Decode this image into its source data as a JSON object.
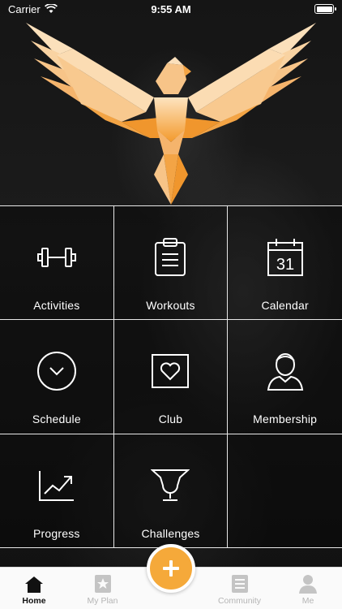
{
  "status_bar": {
    "carrier": "Carrier",
    "time": "9:55 AM"
  },
  "grid": [
    {
      "label": "Activities",
      "icon": "dumbbell-icon"
    },
    {
      "label": "Workouts",
      "icon": "clipboard-icon"
    },
    {
      "label": "Calendar",
      "icon": "calendar-icon",
      "icon_text": "31"
    },
    {
      "label": "Schedule",
      "icon": "chevron-circle-icon"
    },
    {
      "label": "Club",
      "icon": "heart-box-icon"
    },
    {
      "label": "Membership",
      "icon": "user-icon"
    },
    {
      "label": "Progress",
      "icon": "trend-chart-icon"
    },
    {
      "label": "Challenges",
      "icon": "trophy-icon"
    },
    {
      "label": "",
      "icon": ""
    }
  ],
  "tabbar": {
    "home": "Home",
    "my_plan": "My Plan",
    "community": "Community",
    "me": "Me"
  },
  "colors": {
    "accent": "#f5a93a",
    "grid_line": "#e8e8e8",
    "tab_active": "#111111",
    "tab_inactive": "#b5b5b5"
  }
}
